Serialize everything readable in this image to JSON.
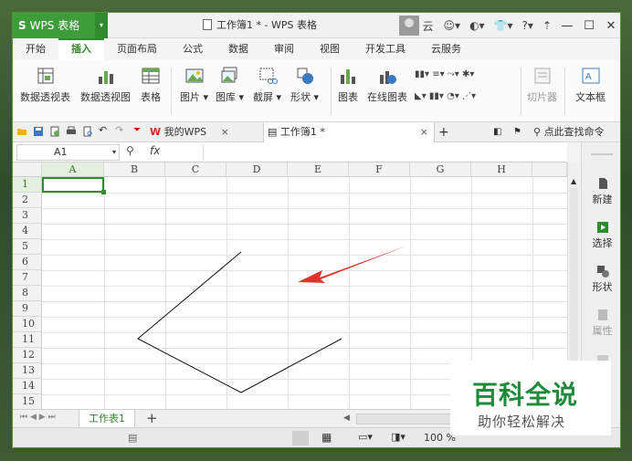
{
  "app": {
    "name": "WPS 表格",
    "doc_title": "工作簿1 * - WPS 表格",
    "cloud": "云"
  },
  "tabs": [
    "开始",
    "插入",
    "页面布局",
    "公式",
    "数据",
    "审阅",
    "视图",
    "开发工具",
    "云服务"
  ],
  "active_tab": "插入",
  "ribbon": {
    "pivot_table": "数据透视表",
    "pivot_chart": "数据透视图",
    "table": "表格",
    "picture": "图片",
    "gallery": "图库",
    "screenshot": "截屏",
    "shapes": "形状",
    "chart": "图表",
    "online_chart": "在线图表",
    "clip": "切片器",
    "textbox": "文本框"
  },
  "quick": {
    "mywps": "我的WPS",
    "workbook_tab": "工作簿1 *",
    "search": "点此查找命令"
  },
  "formula_bar": {
    "cell_ref": "A1",
    "fx": "fx"
  },
  "columns": [
    "A",
    "B",
    "C",
    "D",
    "E",
    "F",
    "G",
    "H"
  ],
  "rows": [
    "1",
    "2",
    "3",
    "4",
    "5",
    "6",
    "7",
    "8",
    "9",
    "10",
    "11",
    "12",
    "13",
    "14",
    "15"
  ],
  "right_pane": {
    "new": "新建",
    "select": "选择",
    "shape": "形状",
    "props": "属性"
  },
  "sheet": {
    "name": "工作表1"
  },
  "status": {
    "zoom": "100 %"
  },
  "watermark": {
    "title": "百科全说",
    "subtitle": "助你轻松解决"
  },
  "colors": {
    "accent": "#3f9c3a",
    "arrow": "#e0332b"
  }
}
